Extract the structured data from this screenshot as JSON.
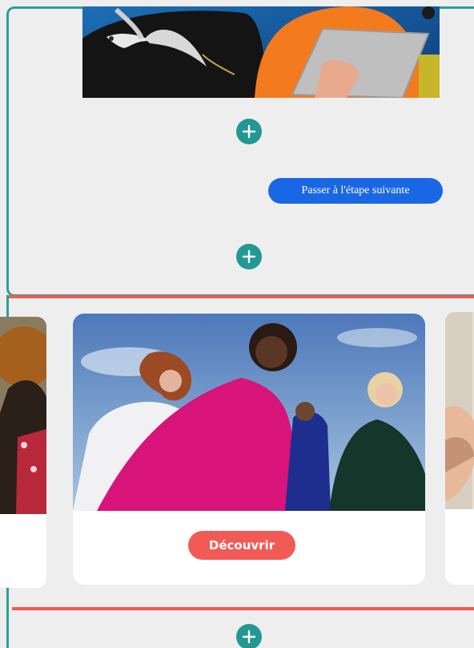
{
  "actions": {
    "next_step_label": "Passer à l'étape suivante",
    "discover_label": "Découvrir"
  },
  "icons": {
    "add_block": "plus-circle-icon"
  },
  "colors": {
    "teal": "#2aa09a",
    "accent_red": "#f25a55",
    "primary_blue": "#1a67e6"
  }
}
